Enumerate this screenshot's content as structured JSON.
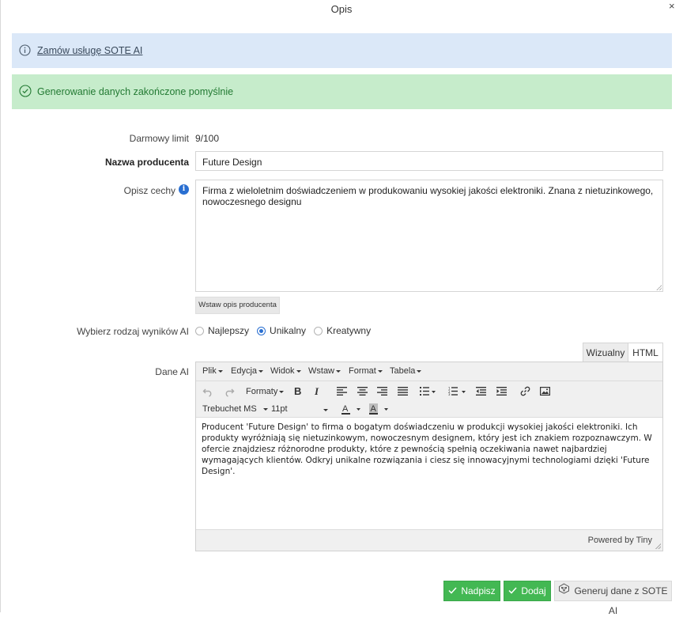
{
  "dialog": {
    "title": "Opis",
    "close": "×"
  },
  "alerts": {
    "info_link": "Zamów usługę SOTE AI",
    "success_message": "Generowanie danych zakończone pomyślnie"
  },
  "form": {
    "free_limit_label": "Darmowy limit",
    "free_limit_value": "9/100",
    "manufacturer_label": "Nazwa producenta",
    "manufacturer_value": "Future Design",
    "describe_label": "Opisz cechy",
    "describe_value": "Firma z wieloletnim doświadczeniem w produkowaniu wysokiej jakości elektroniki. Znana z nietuzinkowego, nowoczesnego designu",
    "insert_button": "Wstaw opis producenta",
    "result_type_label": "Wybierz rodzaj wyników AI",
    "result_options": [
      {
        "label": "Najlepszy",
        "selected": false
      },
      {
        "label": "Unikalny",
        "selected": true
      },
      {
        "label": "Kreatywny",
        "selected": false
      }
    ],
    "ai_data_label": "Dane AI"
  },
  "editor": {
    "tabs": [
      "Wizualny",
      "HTML"
    ],
    "active_tab": "Wizualny",
    "menu": [
      "Plik",
      "Edycja",
      "Widok",
      "Wstaw",
      "Format",
      "Tabela"
    ],
    "formats_label": "Formaty",
    "font_family": "Trebuchet MS",
    "font_size": "11pt",
    "content": "Producent 'Future Design' to firma o bogatym doświadczeniu w produkcji wysokiej jakości elektroniki. Ich produkty wyróżniają się nietuzinkowym, nowoczesnym designem, który jest ich znakiem rozpoznawczym. W ofercie znajdziesz różnorodne produkty, które z pewnością spełnią oczekiwania nawet najbardziej wymagających klientów. Odkryj unikalne rozwiązania i ciesz się innowacyjnymi technologiami dzięki 'Future Design'.",
    "powered_by": "Powered by Tiny"
  },
  "actions": {
    "overwrite": "Nadpisz",
    "add": "Dodaj",
    "generate": "Generuj dane z SOTE AI"
  },
  "colors": {
    "info_bg": "#dbe8f8",
    "success_bg": "#c6eccb",
    "success_text": "#237a33",
    "primary_button": "#43b853",
    "radio_accent": "#2a6fd1"
  }
}
